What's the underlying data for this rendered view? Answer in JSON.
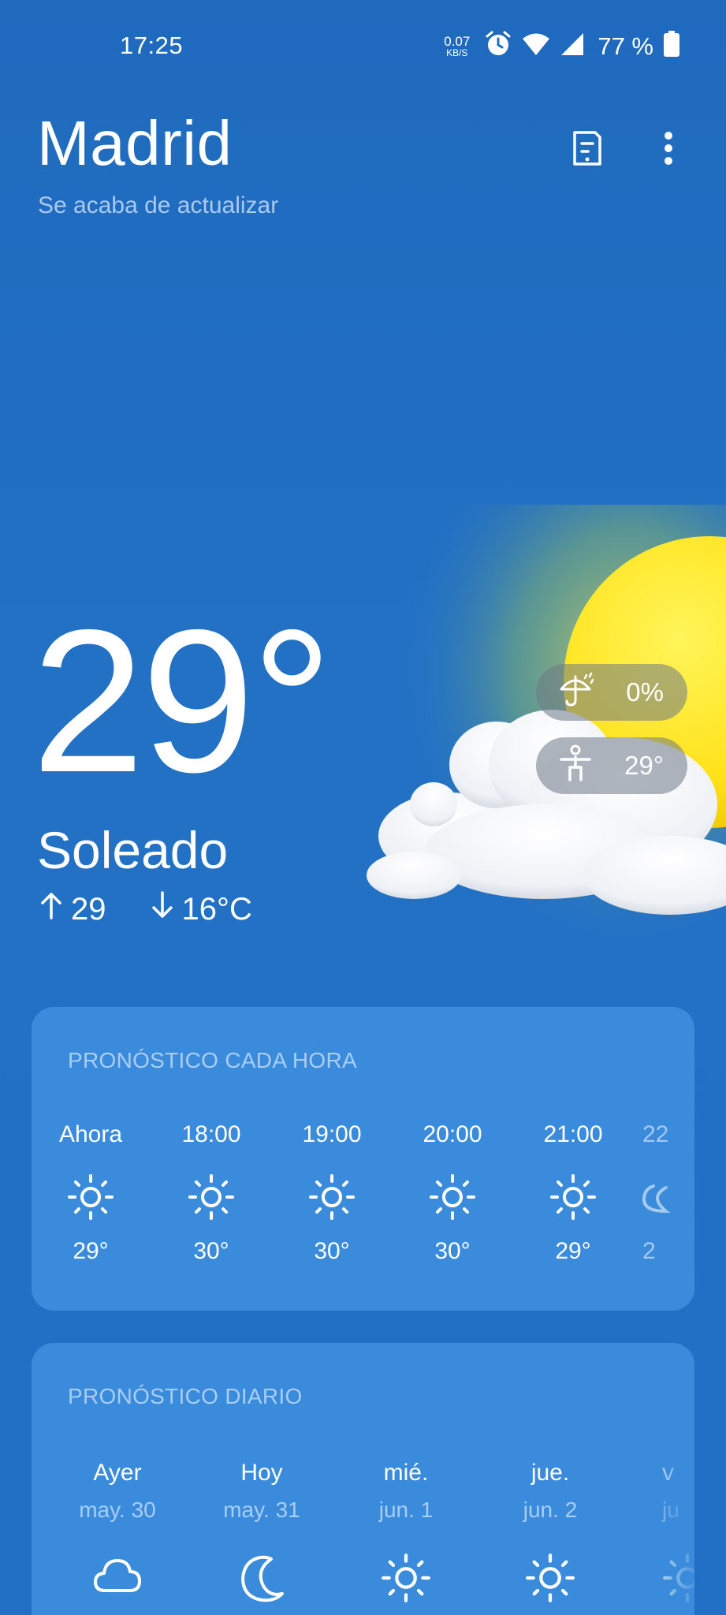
{
  "status_bar": {
    "time": "17:25",
    "net_speed_value": "0.07",
    "net_speed_unit": "KB/S",
    "battery": "77 %",
    "icons": [
      "alarm-icon",
      "wifi-icon",
      "signal-icon",
      "battery-icon"
    ]
  },
  "header": {
    "city": "Madrid",
    "updated": "Se acaba de actualizar",
    "actions": [
      "doc-icon",
      "more-vert-icon"
    ]
  },
  "current": {
    "temperature": "29°",
    "condition": "Soleado",
    "high": "29",
    "low": "16°C",
    "rain_chance": "0%",
    "feels_like": "29°"
  },
  "hourly": {
    "title": "PRONÓSTICO CADA HORA",
    "items": [
      {
        "time": "Ahora",
        "icon": "sun-icon",
        "temp": "29°"
      },
      {
        "time": "18:00",
        "icon": "sun-icon",
        "temp": "30°"
      },
      {
        "time": "19:00",
        "icon": "sun-icon",
        "temp": "30°"
      },
      {
        "time": "20:00",
        "icon": "sun-icon",
        "temp": "30°"
      },
      {
        "time": "21:00",
        "icon": "sun-icon",
        "temp": "29°"
      },
      {
        "time": "22",
        "icon": "moon-icon",
        "temp": "2"
      }
    ]
  },
  "daily": {
    "title": "PRONÓSTICO DIARIO",
    "items": [
      {
        "name": "Ayer",
        "date": "may. 30",
        "icon": "cloud-icon"
      },
      {
        "name": "Hoy",
        "date": "may. 31",
        "icon": "moon-icon"
      },
      {
        "name": "mié.",
        "date": "jun. 1",
        "icon": "sun-icon"
      },
      {
        "name": "jue.",
        "date": "jun. 2",
        "icon": "sun-icon"
      },
      {
        "name": "v",
        "date": "ju",
        "icon": "sun-icon"
      }
    ]
  },
  "colors": {
    "background": "#2170c6",
    "card": "#3a8bdb",
    "muted_text": "#a9cdf3",
    "chip": "#6e7887"
  }
}
